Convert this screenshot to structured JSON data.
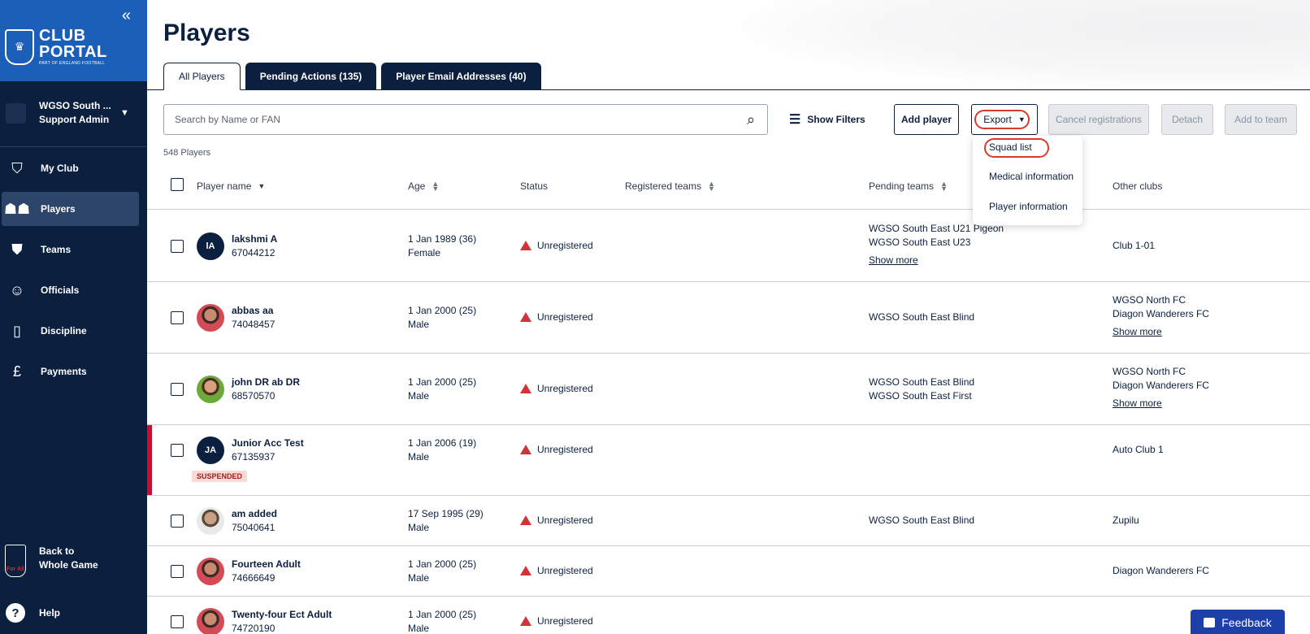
{
  "sidebar": {
    "logo": {
      "line1": "CLUB",
      "line2": "PORTAL",
      "line3": "PART OF ENGLAND FOOTBALL"
    },
    "org": {
      "name": "WGSO South ...",
      "role": "Support Admin"
    },
    "nav": [
      {
        "label": "My Club",
        "icon": "club-crest-icon"
      },
      {
        "label": "Players",
        "icon": "players-icon"
      },
      {
        "label": "Teams",
        "icon": "shield-icon"
      },
      {
        "label": "Officials",
        "icon": "officials-icon"
      },
      {
        "label": "Discipline",
        "icon": "cards-icon"
      },
      {
        "label": "Payments",
        "icon": "pound-icon"
      }
    ],
    "back_label": "Back to Whole Game",
    "back_crest_text": "For All",
    "help_label": "Help"
  },
  "page": {
    "title": "Players"
  },
  "tabs": [
    {
      "label": "All Players",
      "active": true
    },
    {
      "label": "Pending Actions (135)",
      "active": false
    },
    {
      "label": "Player Email Addresses (40)",
      "active": false
    }
  ],
  "toolbar": {
    "search_placeholder": "Search by Name or FAN",
    "show_filters": "Show Filters",
    "add_player": "Add player",
    "export": "Export",
    "cancel_registrations": "Cancel registrations",
    "detach": "Detach",
    "add_to_team": "Add to team"
  },
  "export_menu": [
    "Squad list",
    "Medical information",
    "Player information"
  ],
  "count_label": "548 Players",
  "columns": {
    "player_name": "Player name",
    "age": "Age",
    "status": "Status",
    "registered_teams": "Registered teams",
    "pending_teams": "Pending teams",
    "other_clubs": "Other clubs"
  },
  "rows": [
    {
      "name": "lakshmi A",
      "fan": "67044212",
      "avatar": "lA",
      "dob": "1 Jan 1989 (36)",
      "sex": "Female",
      "status": "Unregistered",
      "pending": [
        "WGSO South East U21 Pigeon",
        "WGSO South East U23"
      ],
      "pending_more": "Show more",
      "clubs": [
        "Club 1-01"
      ],
      "clubs_more": ""
    },
    {
      "name": "abbas aa",
      "fan": "74048457",
      "avatar": "",
      "dob": "1 Jan 2000 (25)",
      "sex": "Male",
      "status": "Unregistered",
      "pending": [
        "WGSO South East Blind"
      ],
      "pending_more": "",
      "clubs": [
        "WGSO North FC",
        "Diagon Wanderers FC"
      ],
      "clubs_more": "Show more"
    },
    {
      "name": "john DR ab DR",
      "fan": "68570570",
      "avatar": "",
      "dob": "1 Jan 2000 (25)",
      "sex": "Male",
      "status": "Unregistered",
      "pending": [
        "WGSO South East Blind",
        "WGSO South East First"
      ],
      "pending_more": "",
      "clubs": [
        "WGSO North FC",
        "Diagon Wanderers FC"
      ],
      "clubs_more": "Show more"
    },
    {
      "name": "Junior Acc Test",
      "fan": "67135937",
      "avatar": "JA",
      "badge": "SUSPENDED",
      "dob": "1 Jan 2006 (19)",
      "sex": "Male",
      "status": "Unregistered",
      "pending": [],
      "pending_more": "",
      "clubs": [
        "Auto Club 1"
      ],
      "clubs_more": ""
    },
    {
      "name": "am added",
      "fan": "75040641",
      "avatar": "",
      "dob": "17 Sep 1995 (29)",
      "sex": "Male",
      "status": "Unregistered",
      "pending": [
        "WGSO South East Blind"
      ],
      "pending_more": "",
      "clubs": [
        "Zupilu"
      ],
      "clubs_more": ""
    },
    {
      "name": "Fourteen Adult",
      "fan": "74666649",
      "avatar": "",
      "dob": "1 Jan 2000 (25)",
      "sex": "Male",
      "status": "Unregistered",
      "pending": [],
      "pending_more": "",
      "clubs": [
        "Diagon Wanderers FC"
      ],
      "clubs_more": ""
    },
    {
      "name": "Twenty-four Ect Adult",
      "fan": "74720190",
      "avatar": "",
      "dob": "1 Jan 2000 (25)",
      "sex": "Male",
      "status": "Unregistered",
      "pending": [],
      "pending_more": "",
      "clubs": [],
      "clubs_more": ""
    }
  ],
  "feedback_label": "Feedback",
  "colors": {
    "navy": "#0b1f3f",
    "brand_blue": "#1b5fb8",
    "highlight_red": "#d93a2b",
    "warning_red": "#d13438",
    "feedback_blue": "#1c3fa8"
  }
}
